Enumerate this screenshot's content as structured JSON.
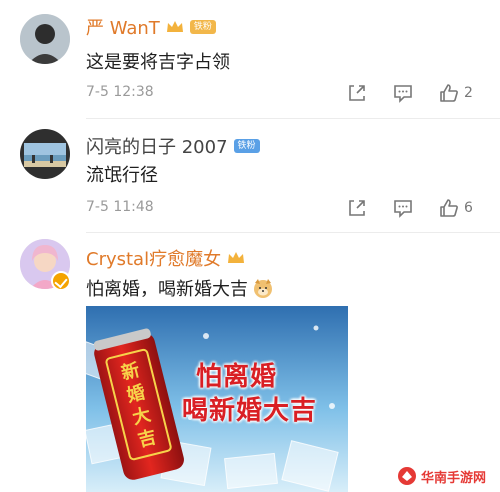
{
  "comments": [
    {
      "username": "严 WanT",
      "badge": "铁粉",
      "text": "这是要将吉字占领",
      "time": "7-5 12:38",
      "likes": "2"
    },
    {
      "username": "闪亮的日子 2007",
      "badge": "铁粉",
      "text": "流氓行径",
      "time": "7-5 11:48",
      "likes": "6"
    },
    {
      "username": "Crystal疗愈魔女",
      "text": "怕离婚，喝新婚大吉",
      "promo_can": "新婚大吉",
      "promo_line1": "怕离婚",
      "promo_line2": "喝新婚大吉"
    }
  ],
  "watermark": "华南手游网",
  "icons": {
    "share": "share-icon",
    "comment": "comment-icon",
    "like": "thumbs-up-icon",
    "vip": "verified-badge-icon",
    "emoji": "doge-emoji-icon"
  },
  "colors": {
    "username_accent": "#e07a2a",
    "badge_blue": "#5aa0e6",
    "badge_gold": "#f2b74a",
    "promo_red": "#d91f24"
  }
}
